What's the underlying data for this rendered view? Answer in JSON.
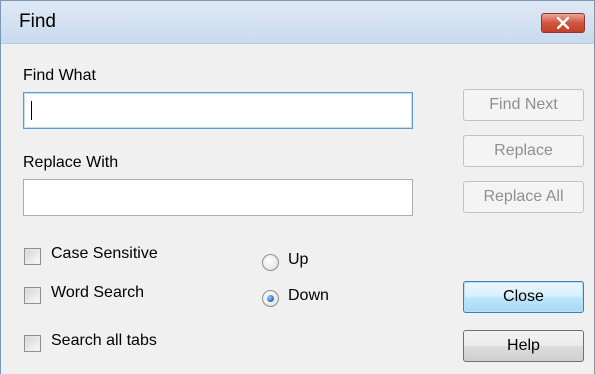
{
  "window": {
    "title": "Find",
    "close_label": "Close window"
  },
  "fields": {
    "find_label": "Find What",
    "find_value": "",
    "replace_label": "Replace With",
    "replace_value": ""
  },
  "options": {
    "case_sensitive": {
      "label": "Case Sensitive",
      "checked": false
    },
    "word_search": {
      "label": "Word Search",
      "checked": false
    },
    "search_all_tabs": {
      "label": "Search all tabs",
      "checked": false
    }
  },
  "direction": {
    "up": {
      "label": "Up",
      "selected": false
    },
    "down": {
      "label": "Down",
      "selected": true
    }
  },
  "buttons": {
    "find_next": {
      "label": "Find Next",
      "enabled": false
    },
    "replace": {
      "label": "Replace",
      "enabled": false
    },
    "replace_all": {
      "label": "Replace All",
      "enabled": false
    },
    "close": {
      "label": "Close",
      "enabled": true
    },
    "help": {
      "label": "Help",
      "enabled": true
    }
  },
  "colors": {
    "titlebar": "#c9daee",
    "close_button": "#d0553f",
    "dialog_bg": "#f0f0f0",
    "focus_border": "#5b9bd5"
  }
}
